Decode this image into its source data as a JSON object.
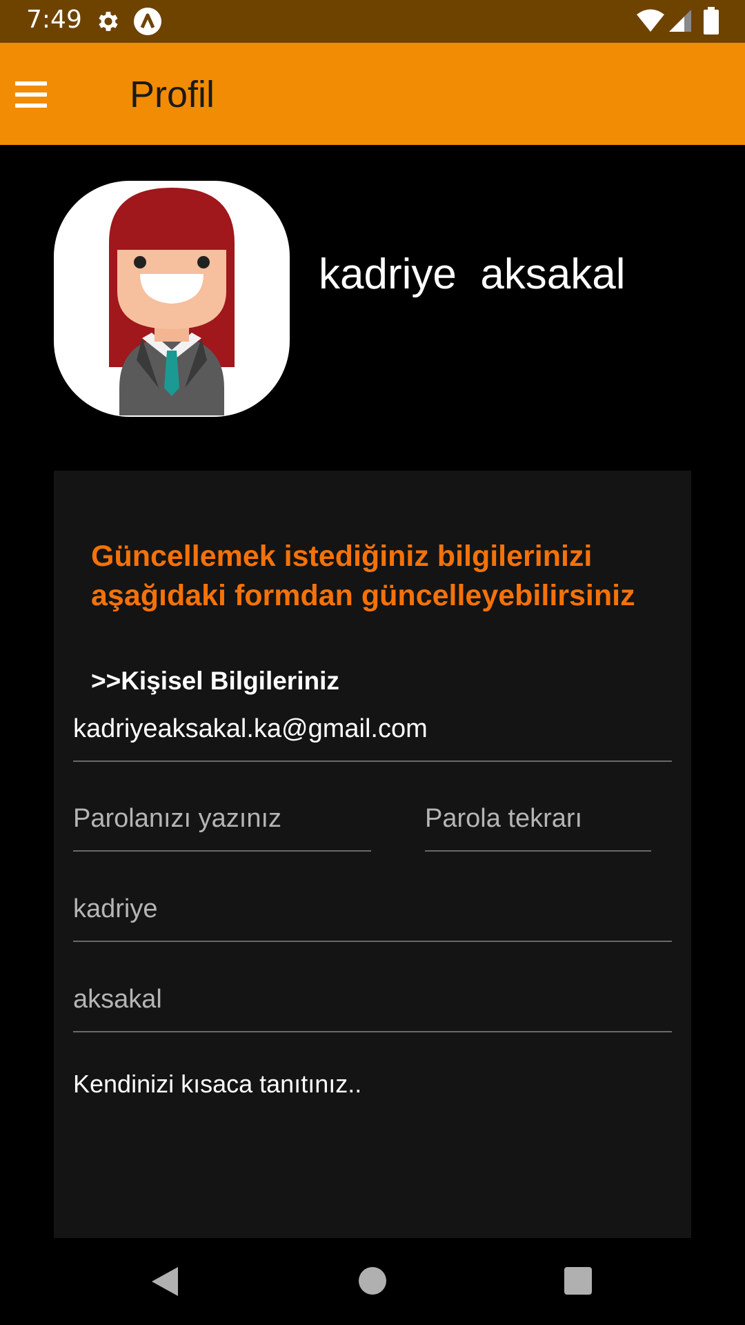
{
  "status_bar": {
    "time": "7:49"
  },
  "app_bar": {
    "title": "Profil"
  },
  "profile": {
    "name": "kadriye  aksakal"
  },
  "form": {
    "heading": "Güncellemek istediğiniz bilgilerinizi aşağıdaki formdan güncelleyebilirsiniz",
    "section_title": ">>Kişisel Bilgileriniz",
    "email_value": "kadriyeaksakal.ka@gmail.com",
    "password_placeholder": "Parolanızı yazınız",
    "password_repeat_placeholder": "Parola tekrarı",
    "first_name_value": "kadriye",
    "last_name_value": "aksakal",
    "bio_placeholder": "Kendinizi kısaca tanıtınız.."
  },
  "colors": {
    "status_bar": "#6e4300",
    "app_bar": "#f18c04",
    "heading_accent": "#f4720a",
    "card_background": "#141414"
  },
  "icons": [
    "gear-icon",
    "app-a-icon",
    "wifi-icon",
    "signal-icon",
    "battery-icon",
    "menu-icon",
    "back-icon",
    "home-icon",
    "recents-icon"
  ]
}
